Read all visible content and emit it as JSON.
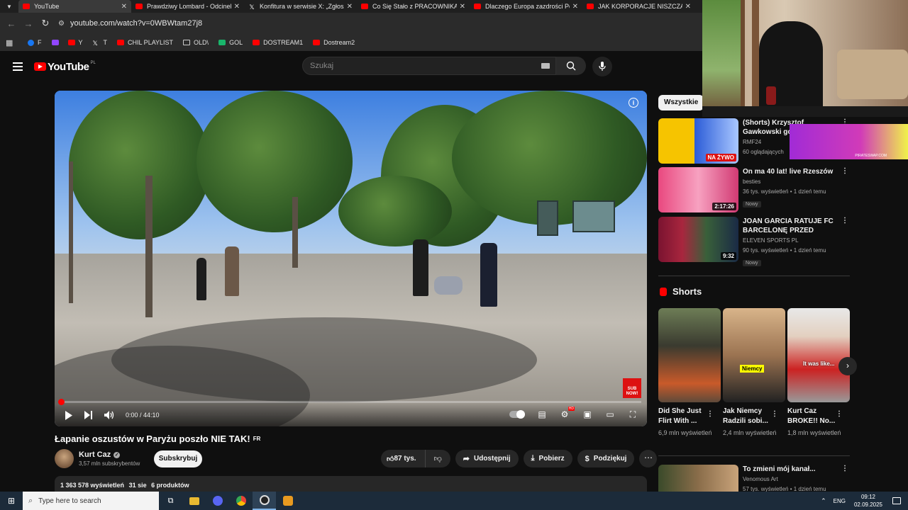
{
  "browser": {
    "tabs": [
      {
        "title": "YouTube",
        "active": true
      },
      {
        "title": "Prawdziwy Lombard - Odcinek"
      },
      {
        "title": "Konfitura w serwisie X: „Zgłosz"
      },
      {
        "title": "Co Się Stało z PRACOWNIKAMI"
      },
      {
        "title": "Dlaczego Europa zazdrości Pol"
      },
      {
        "title": "JAK KORPORACJE NISZCZĄ PO"
      }
    ],
    "url": "youtube.com/watch?v=0WBWtam27j8",
    "bookmarks": [
      {
        "label": "F",
        "icon": "facebook-icon"
      },
      {
        "label": "",
        "icon": "twitch-icon"
      },
      {
        "label": "Y",
        "icon": "youtube-icon"
      },
      {
        "label": "T",
        "icon": "x-icon"
      },
      {
        "label": "CHIL PLAYLIST",
        "icon": "youtube-icon"
      },
      {
        "label": "OLD\\",
        "icon": "folder-icon"
      },
      {
        "label": "GOL",
        "icon": "gol-icon"
      },
      {
        "label": "DOSTREAM1",
        "icon": "youtube-icon"
      },
      {
        "label": "Dostream2",
        "icon": "youtube-icon"
      }
    ]
  },
  "header": {
    "logo_text": "YouTube",
    "country": "PL",
    "search_placeholder": "Szukaj"
  },
  "player": {
    "time": "0:00 / 44:10",
    "progress": 0.0,
    "subnow": "SUB NOW!"
  },
  "video": {
    "title": "Łapanie oszustów w Paryżu poszło NIE TAK!",
    "flag": "FR",
    "channel": "Kurt Caz",
    "subs": "3,57 mln subskrybentów",
    "subscribe": "Subskrybuj",
    "likes": "87 tys.",
    "share": "Udostępnij",
    "download": "Pobierz",
    "thanks": "Podziękuj",
    "views": "1 363 578 wyświetleń",
    "date": "31 sie",
    "products": "6 produktów"
  },
  "sidebar": {
    "chip": "Wszystkie",
    "recs": [
      {
        "title": "(Shorts) Krzysztof Gawkowski gościem Porann",
        "channel": "RMF24",
        "meta": "60 oglądających",
        "duration": "",
        "live": "NA ŻYWO"
      },
      {
        "title": "On ma 40 lat! live Rzeszów",
        "channel": "besties",
        "meta": "36 tys. wyświetleń • 1 dzień temu",
        "badge": "Nowy",
        "duration": "2:17:26"
      },
      {
        "title": "JOAN GARCIA RATUJE FC BARCELONĘ PRZED PORAŻKĄ...",
        "channel": "ELEVEN SPORTS PL",
        "meta": "90 tys. wyświetleń • 1 dzień temu",
        "badge": "Nowy",
        "duration": "9:32"
      }
    ],
    "shorts_title": "Shorts",
    "shorts": [
      {
        "title": "Did She Just Flirt With ...",
        "views": "6,9 mln wyświetleń"
      },
      {
        "title": "Jak Niemcy Radzili sobi...",
        "views": "2,4 mln wyświetleń",
        "caption": "Niemcy"
      },
      {
        "title": "Kurt Caz BROKE!! No...",
        "views": "1,8 mln wyświetleń",
        "caption": "It was like..."
      }
    ],
    "bottom_rec": {
      "title": "To zmieni mój kanał...",
      "channel": "Venomous Art",
      "meta": "57 tys. wyświetleń • 1 dzień temu"
    }
  },
  "overlay": {
    "ad_text": "PIRATESWAP.COM"
  },
  "taskbar": {
    "search": "Type here to search",
    "lang": "ENG",
    "time": "09:12",
    "date": "02.09.2025"
  }
}
